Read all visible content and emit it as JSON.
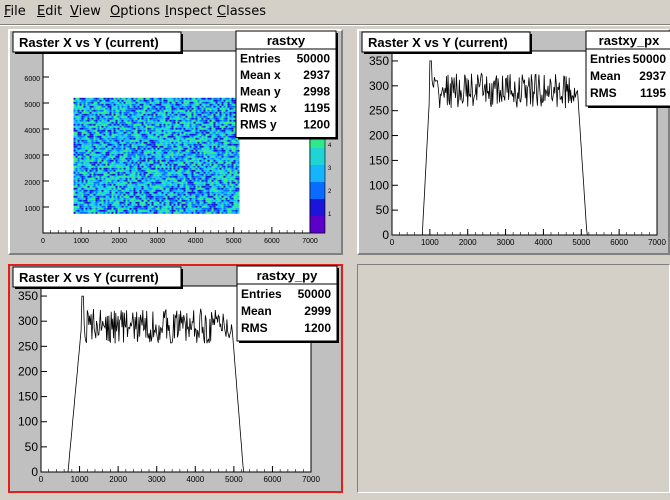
{
  "menu": {
    "items": [
      "File",
      "Edit",
      "View",
      "Options",
      "Inspect",
      "Classes"
    ],
    "underline_first_letter": true
  },
  "pads": [
    {
      "id": "rastxy",
      "title": "Raster X vs Y (current)",
      "stats": {
        "name": "rastxy",
        "rows": [
          {
            "label": "Entries",
            "value": "50000"
          },
          {
            "label": "Mean x",
            "value": "2937"
          },
          {
            "label": "Mean y",
            "value": "2998"
          },
          {
            "label": "RMS x",
            "value": "1195"
          },
          {
            "label": "RMS y",
            "value": "1200"
          }
        ]
      },
      "selected": false
    },
    {
      "id": "rastxy_px",
      "title": "Raster X vs Y (current)",
      "stats": {
        "name": "rastxy_px",
        "rows": [
          {
            "label": "Entries",
            "value": "50000"
          },
          {
            "label": "Mean",
            "value": "2937"
          },
          {
            "label": "RMS",
            "value": "1195"
          }
        ]
      },
      "selected": false
    },
    {
      "id": "rastxy_py",
      "title": "Raster X vs Y (current)",
      "stats": {
        "name": "rastxy_py",
        "rows": [
          {
            "label": "Entries",
            "value": "50000"
          },
          {
            "label": "Mean",
            "value": "2999"
          },
          {
            "label": "RMS",
            "value": "1200"
          }
        ]
      },
      "selected": true
    }
  ],
  "chart_data": [
    {
      "type": "heatmap",
      "title": "Raster X vs Y (current)",
      "xlim": [
        0,
        7000
      ],
      "ylim": [
        0,
        7000
      ],
      "x_ticks": [
        "0",
        "1000",
        "2000",
        "3000",
        "4000",
        "5000",
        "6000",
        "7000"
      ],
      "y_ticks": [
        "1000",
        "2000",
        "3000",
        "4000",
        "5000",
        "6000"
      ],
      "filled_region": {
        "x": [
          800,
          5100
        ],
        "y": [
          800,
          5200
        ]
      },
      "z_ticks": [
        "1",
        "2",
        "3",
        "4"
      ],
      "colors": [
        "#1c14d8",
        "#0a6cff",
        "#16b4ff",
        "#20d4d4",
        "#2ee88a"
      ]
    },
    {
      "type": "line",
      "title": "Raster X vs Y (current)",
      "xlim": [
        0,
        7000
      ],
      "ylim": [
        0,
        370
      ],
      "x_ticks": [
        "0",
        "1000",
        "2000",
        "3000",
        "4000",
        "5000",
        "6000",
        "7000"
      ],
      "y_ticks": [
        "0",
        "50",
        "100",
        "150",
        "200",
        "250",
        "300",
        "350"
      ],
      "profile": {
        "rise_start": 800,
        "rise_end": 1000,
        "plateau": 290,
        "fall_start": 4900,
        "fall_end": 5150,
        "first_peak": 350
      }
    },
    {
      "type": "line",
      "title": "Raster X vs Y (current)",
      "xlim": [
        0,
        7000
      ],
      "ylim": [
        0,
        370
      ],
      "x_ticks": [
        "0",
        "1000",
        "2000",
        "3000",
        "4000",
        "5000",
        "6000",
        "7000"
      ],
      "y_ticks": [
        "0",
        "50",
        "100",
        "150",
        "200",
        "250",
        "300",
        "350"
      ],
      "profile": {
        "rise_start": 700,
        "rise_end": 1050,
        "plateau": 290,
        "fall_start": 4950,
        "fall_end": 5250,
        "first_peak": 350
      }
    }
  ]
}
